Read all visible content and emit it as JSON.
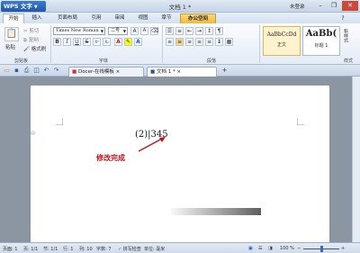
{
  "app": {
    "menu_button": "WPS 文字",
    "doc_title": "文档 1 *",
    "login": "未登录",
    "win_min": "–",
    "win_max": "❐",
    "win_close": "✕"
  },
  "menu_tabs": [
    "开始",
    "插入",
    "页面布局",
    "引用",
    "审阅",
    "视图",
    "章节",
    "办公空间"
  ],
  "ribbon": {
    "paste": "粘贴",
    "cut": "剪切",
    "copy": "复制",
    "format_painter": "格式刷",
    "font_name": "Times New Roman",
    "font_size": "二号",
    "style1_sample": "AaBbCcDd",
    "style1_name": "正文",
    "style2_sample": "AaBb(",
    "style2_name": "标题 1",
    "new_style": "新样式",
    "groups": {
      "clipboard": "剪贴板",
      "font": "字体",
      "paragraph": "段落",
      "styles": "样式"
    }
  },
  "doc_tabs": {
    "tab1": "Docer-在线模板",
    "tab2": "文档 1 *",
    "add": "+"
  },
  "document": {
    "text_before": "(2)|345",
    "annotation": "修改完成"
  },
  "status": {
    "page": "页面: 1",
    "pages": "页: 1/1",
    "section": "节: 1/1",
    "row": "行: 1",
    "col": "列: 10",
    "words": "字数: 7",
    "spell": "拼写检查",
    "unit": "单位: 毫米",
    "zoom": "100 %"
  },
  "colors": {
    "accent": "#1f56a8",
    "annotation": "#c0141c",
    "page_bg": "#ffffff",
    "workspace": "#8c96a2"
  }
}
